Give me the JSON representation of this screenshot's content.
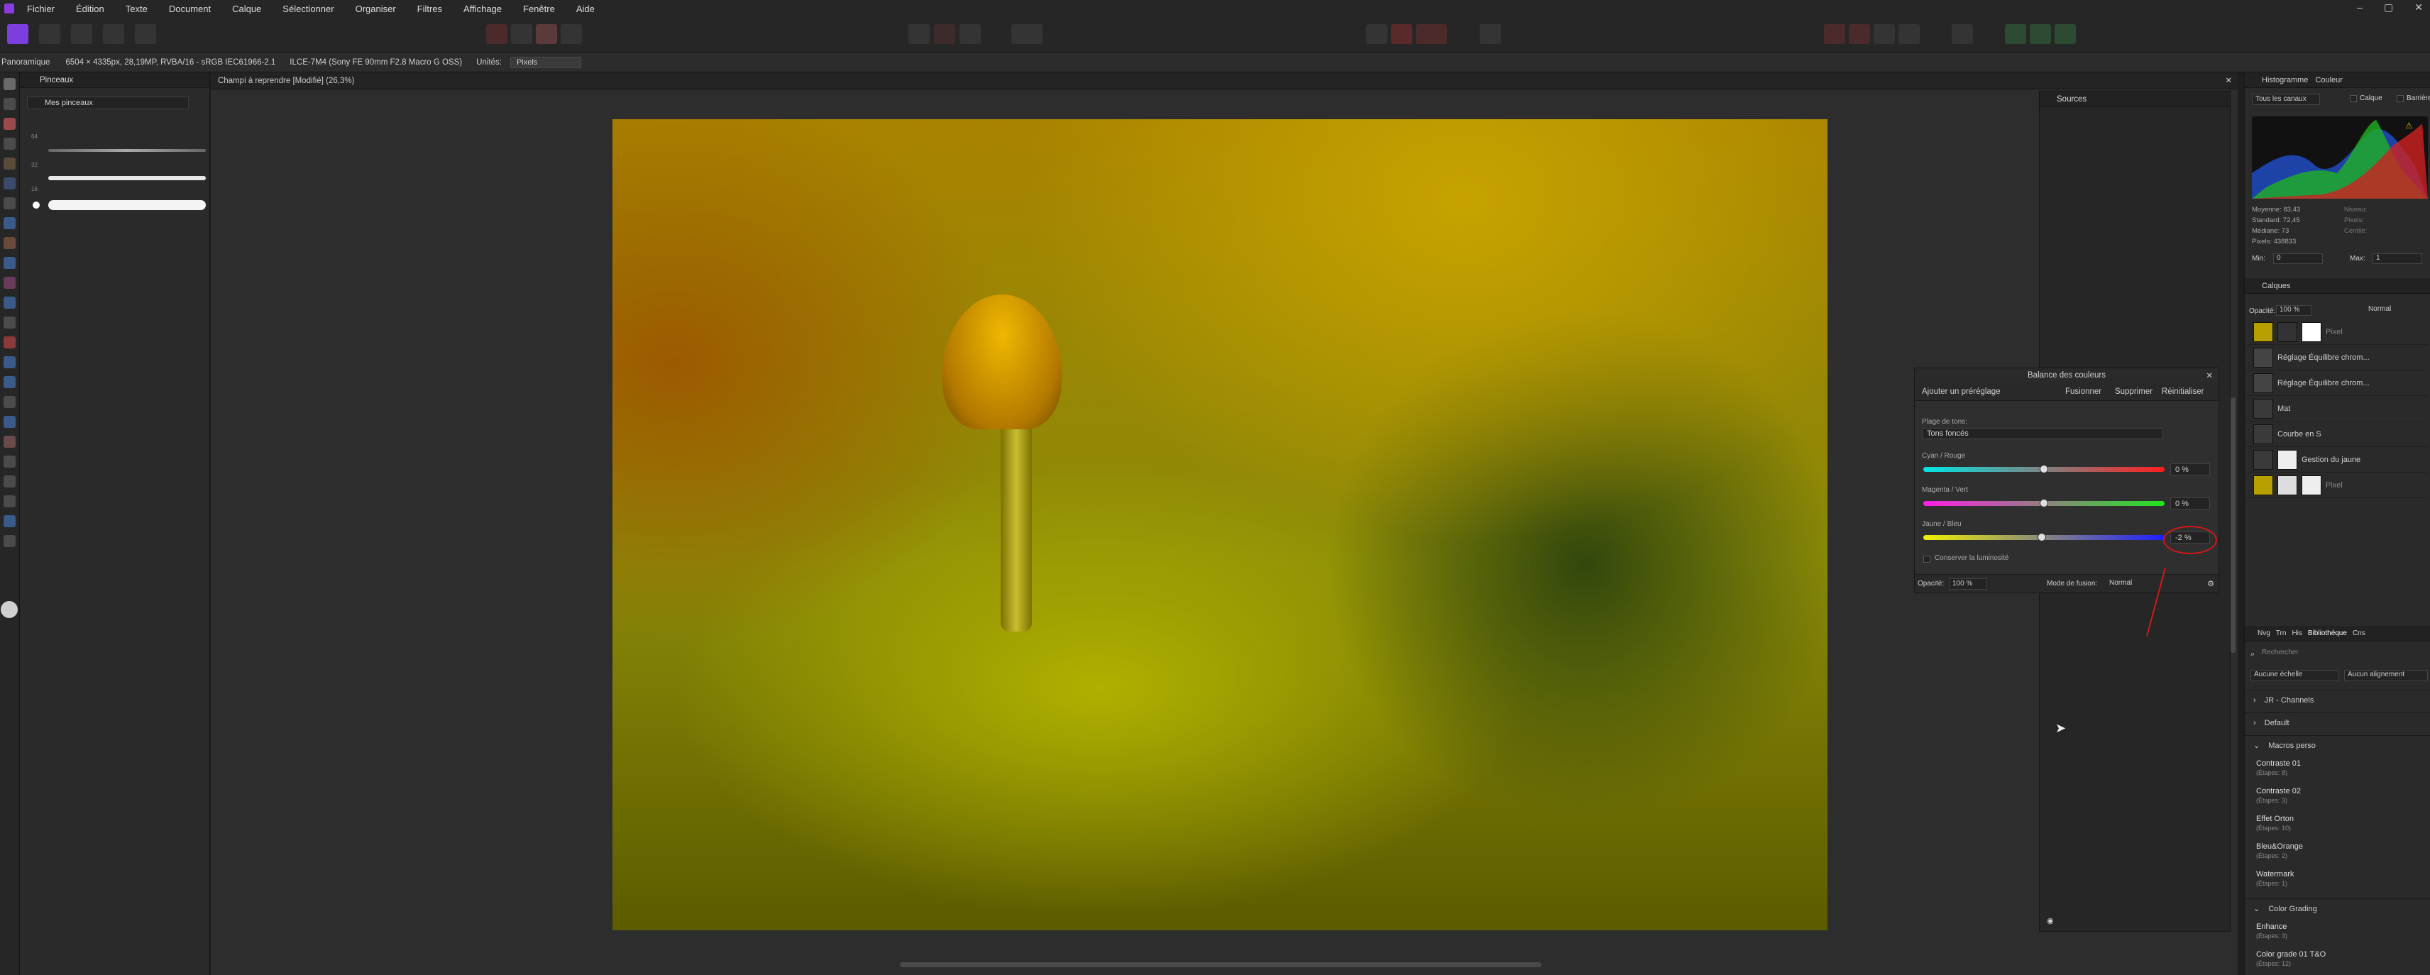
{
  "menu": [
    "Fichier",
    "Édition",
    "Texte",
    "Document",
    "Calque",
    "Sélectionner",
    "Organiser",
    "Filtres",
    "Affichage",
    "Fenêtre",
    "Aide"
  ],
  "context": {
    "tool": "Panoramique",
    "info": "6504 × 4335px, 28,19MP, RVBA/16 - sRGB IEC61966-2.1",
    "camera": "ILCE-7M4 (Sony FE 90mm F2.8 Macro G OSS)",
    "units_label": "Unités:",
    "units_value": "Pixels"
  },
  "brushes": {
    "tab": "Pinceaux",
    "category": "Mes pinceaux",
    "sizes": [
      "64",
      "",
      "",
      "32",
      "16"
    ]
  },
  "document": {
    "tab": "Champi à reprendre [Modifié] (26,3%)"
  },
  "sources": {
    "title": "Sources"
  },
  "colorbalance": {
    "title": "Balance des couleurs",
    "add_preset": "Ajouter un préréglage",
    "merge": "Fusionner",
    "delete": "Supprimer",
    "reset": "Réinitialiser",
    "tone_label": "Plage de tons:",
    "tone_value": "Tons foncés",
    "sliders": [
      {
        "label": "Cyan / Rouge",
        "value": "0 %",
        "level": 0.5
      },
      {
        "label": "Magenta / Vert",
        "value": "0 %",
        "level": 0.5
      },
      {
        "label": "Jaune / Bleu",
        "value": "-2 %",
        "level": 0.49
      }
    ],
    "preserve": "Conserver la luminosité",
    "opacity_label": "Opacité:",
    "opacity_value": "100 %",
    "blend_label": "Mode de fusion:",
    "blend_value": "Normal"
  },
  "histogram": {
    "tab1": "Histogramme",
    "tab2": "Couleur",
    "channels": "Tous les canaux",
    "layer_cb": "Calque",
    "marker_cb": "Barrière",
    "stats": [
      "Moyenne: 83,43",
      "Standard: 72,45",
      "Médiane: 73",
      "Pixels: 438833"
    ],
    "stats2": [
      "Niveau:",
      "Pixels:",
      "Centile:"
    ],
    "min_label": "Min:",
    "min_value": "0",
    "max_label": "Max:",
    "max_value": "1"
  },
  "layers": {
    "title": "Calques",
    "opacity_label": "Opacité:",
    "opacity_value": "100 %",
    "blend": "Normal",
    "items": [
      "Pixel",
      "Réglage Équilibre chrom...",
      "Réglage Équilibre chrom...",
      "Mat",
      "Courbe en S",
      "Gestion du jaune",
      "Pixel"
    ]
  },
  "library": {
    "tabs": [
      "Nvg",
      "Trn",
      "His",
      "Bibliothèque",
      "Cns"
    ],
    "search": "Rechercher",
    "scale": "Aucune échelle",
    "align": "Aucun alignement",
    "groups": [
      {
        "name": "JR - Channels"
      },
      {
        "name": "Default"
      },
      {
        "name": "Macros perso"
      }
    ],
    "macros": [
      {
        "name": "Contraste 01",
        "steps": "(Étapes: 8)"
      },
      {
        "name": "Contraste 02",
        "steps": "(Étapes: 3)"
      },
      {
        "name": "Effet Orton",
        "steps": "(Étapes: 10)"
      },
      {
        "name": "Bleu&Orange",
        "steps": "(Étapes: 2)"
      },
      {
        "name": "Watermark",
        "steps": "(Étapes: 1)"
      }
    ],
    "group2": "Color Grading",
    "macros2": [
      {
        "name": "Enhance",
        "steps": "(Étapes: 3)"
      },
      {
        "name": "Color grade 01 T&O",
        "steps": "(Étapes: 12)"
      }
    ]
  }
}
